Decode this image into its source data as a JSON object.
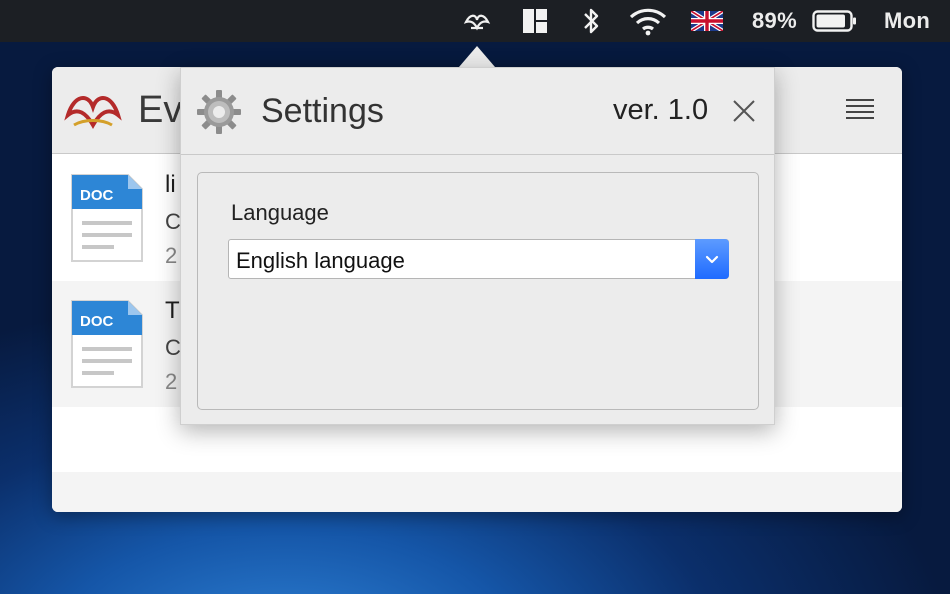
{
  "menubar": {
    "battery_percent": "89%",
    "battery_level": 0.89,
    "clock": "Mon",
    "icons": [
      "app-status-icon",
      "window-layout-icon",
      "bluetooth-icon",
      "wifi-icon",
      "uk-flag-icon",
      "battery-icon"
    ]
  },
  "app": {
    "title": "Ev",
    "documents": [
      {
        "icon_label": "DOC",
        "title": "li",
        "subtitle": "C",
        "date": "2"
      },
      {
        "icon_label": "DOC",
        "title": "T",
        "subtitle": "C",
        "date": "2"
      }
    ]
  },
  "settings": {
    "title": "Settings",
    "version": "ver. 1.0",
    "language_label": "Language",
    "language_value": "English language"
  },
  "colors": {
    "accent": "#2a76ff",
    "doc_blue": "#2d86d6",
    "logo_red": "#b42a2a"
  }
}
